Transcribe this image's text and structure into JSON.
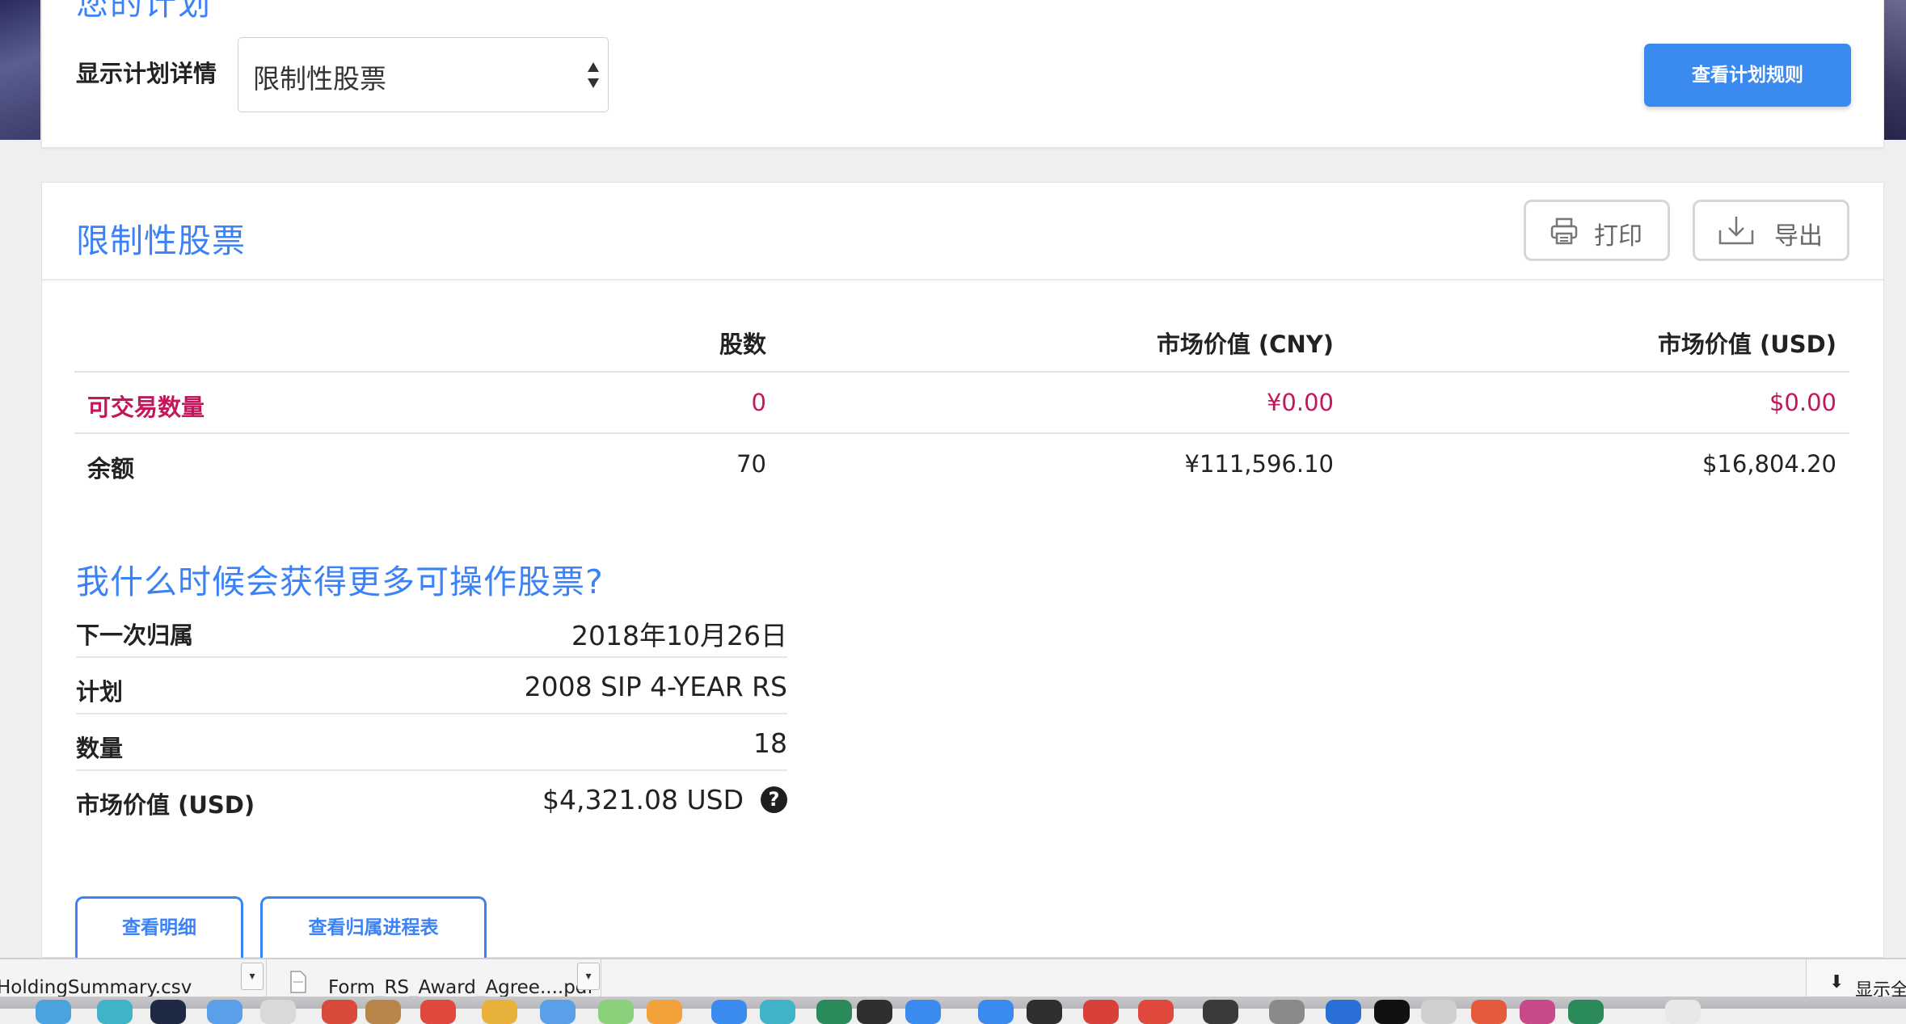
{
  "top_card": {
    "cut_title": "您的计划",
    "plan_label": "显示计划详情",
    "select_value": "限制性股票",
    "rules_button": "查看计划规则"
  },
  "main_card": {
    "title": "限制性股票",
    "print_button": "打印",
    "export_button": "导出",
    "table": {
      "headers": [
        "",
        "股数",
        "市场价值 (CNY)",
        "市场价值 (USD)"
      ],
      "rows": [
        {
          "label": "可交易数量",
          "shares": "0",
          "cny": "¥0.00",
          "usd": "$0.00"
        },
        {
          "label": "余额",
          "shares": "70",
          "cny": "¥111,596.10",
          "usd": "$16,804.20"
        }
      ]
    },
    "question_title": "我什么时候会获得更多可操作股票?",
    "details": [
      {
        "label": "下一次归属",
        "value": "2018年10月26日"
      },
      {
        "label": "计划",
        "value": "2008 SIP 4-YEAR RS"
      },
      {
        "label": "数量",
        "value": "18"
      },
      {
        "label": "市场价值 (USD)",
        "value": "$4,321.08 USD"
      }
    ],
    "help_icon": "question-circle-icon",
    "detail_button": "查看明细",
    "schedule_button": "查看归属进程表"
  },
  "downloads": {
    "items": [
      "HoldingSummary.csv",
      "Form_RS_Award_Agree....pdf"
    ],
    "show_all": "显示全"
  },
  "colors": {
    "accent": "#3b82f6",
    "primary_button": "#3b8aef",
    "pink_row": "#c2185b"
  }
}
